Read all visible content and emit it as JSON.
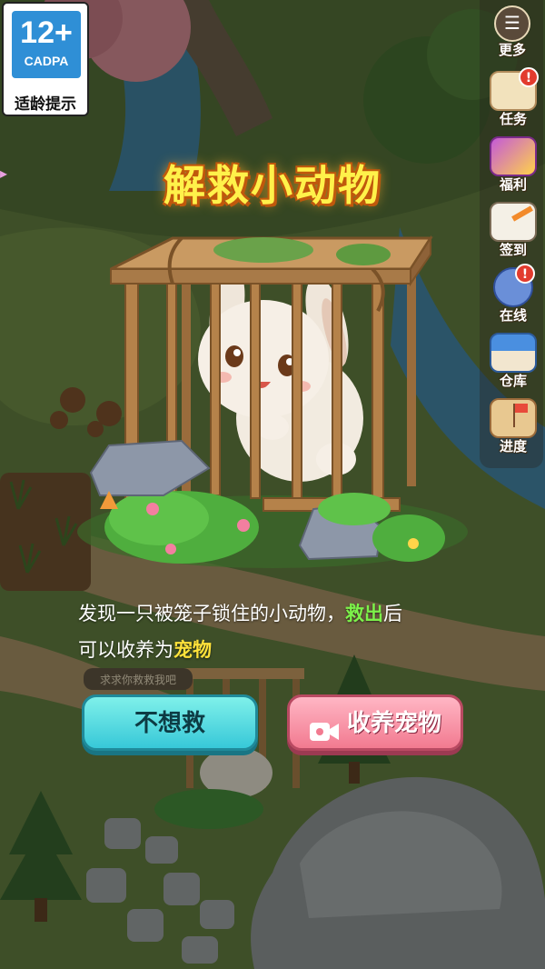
{
  "rating": {
    "age": "12+",
    "org": "CADPA",
    "tip": "适龄提示"
  },
  "sidebar": {
    "more": "更多",
    "items": [
      {
        "label": "任务",
        "badge": "!"
      },
      {
        "label": "福利",
        "badge": ""
      },
      {
        "label": "签到",
        "badge": ""
      },
      {
        "label": "在线",
        "badge": "!"
      },
      {
        "label": "仓库",
        "badge": ""
      },
      {
        "label": "进度",
        "badge": ""
      }
    ]
  },
  "dialog": {
    "title": "解救小动物",
    "desc_part1": "发现一只被笼子锁住的小动物，",
    "desc_green": "救出",
    "desc_part2": "后",
    "desc_part3": "可以收养为",
    "desc_yellow": "宠物",
    "decline_label": "不想救",
    "adopt_label": "收养宠物"
  },
  "background": {
    "speech_bubble": "求求你救救我吧"
  }
}
